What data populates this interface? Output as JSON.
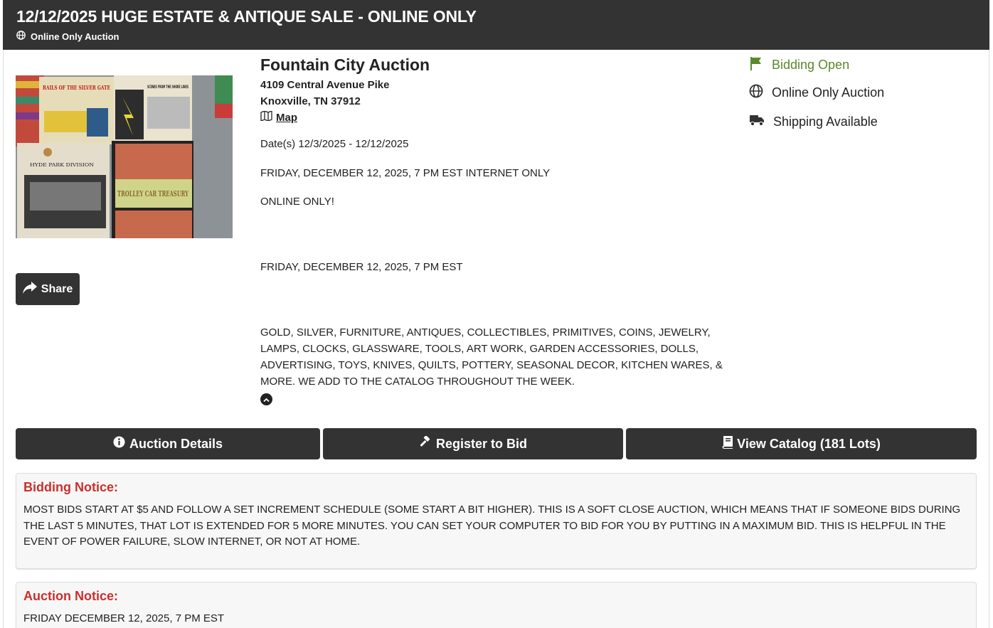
{
  "header": {
    "title": "12/12/2025 HUGE ESTATE & ANTIQUE SALE - ONLINE ONLY",
    "subtitle": "Online Only Auction"
  },
  "image": {
    "books": [
      {
        "text": "RAILS OF THE SILVER GATE",
        "color": "#e7dcb8"
      },
      {
        "text": "SCENES FROM THE SHORE LINES",
        "color": "#e9e3cf"
      },
      {
        "text": "HYDE PARK DIVISION",
        "color": "#e4ddcc"
      },
      {
        "text": "TROLLEY CAR TREASURY",
        "color": "#cfd48a"
      }
    ]
  },
  "share": {
    "label": "Share"
  },
  "auctioneer": {
    "name": "Fountain City Auction",
    "address1": "4109 Central Avenue Pike",
    "address2": "Knoxville, TN 37912",
    "map_label": "Map"
  },
  "details": {
    "dates": "Date(s) 12/3/2025 - 12/12/2025",
    "line1": "FRIDAY, DECEMBER 12, 2025, 7 PM EST INTERNET ONLY",
    "line2": "ONLINE ONLY!",
    "line3": "FRIDAY, DECEMBER 12, 2025, 7 PM EST",
    "description": "GOLD, SILVER, FURNITURE, ANTIQUES, COLLECTIBLES, PRIMITIVES, COINS, JEWELRY, LAMPS, CLOCKS, GLASSWARE, TOOLS, ART WORK, GARDEN ACCESSORIES, DOLLS, ADVERTISING, TOYS, KNIVES, QUILTS, POTTERY, SEASONAL DECOR, KITCHEN WARES, & MORE. WE ADD TO THE CATALOG THROUGHOUT THE WEEK."
  },
  "status": {
    "bidding": "Bidding Open",
    "type": "Online Only Auction",
    "shipping": "Shipping Available",
    "bidding_color": "#5a8a2a"
  },
  "actions": {
    "details": "Auction Details",
    "register": "Register to Bid",
    "catalog": "View Catalog (181 Lots)"
  },
  "bidding_notice": {
    "title": "Bidding Notice:",
    "body": "MOST BIDS START AT $5 AND FOLLOW A SET INCREMENT SCHEDULE (SOME START A BIT HIGHER). THIS IS A SOFT CLOSE AUCTION, WHICH MEANS THAT IF SOMEONE BIDS DURING THE LAST 5 MINUTES, THAT LOT IS EXTENDED FOR 5 MORE MINUTES. YOU CAN SET YOUR COMPUTER TO BID FOR YOU BY PUTTING IN A MAXIMUM BID. THIS IS HELPFUL IN THE EVENT OF POWER FAILURE, SLOW INTERNET, OR NOT AT HOME."
  },
  "auction_notice": {
    "title": "Auction Notice:",
    "body": "FRIDAY DECEMBER 12, 2025, 7 PM EST"
  }
}
